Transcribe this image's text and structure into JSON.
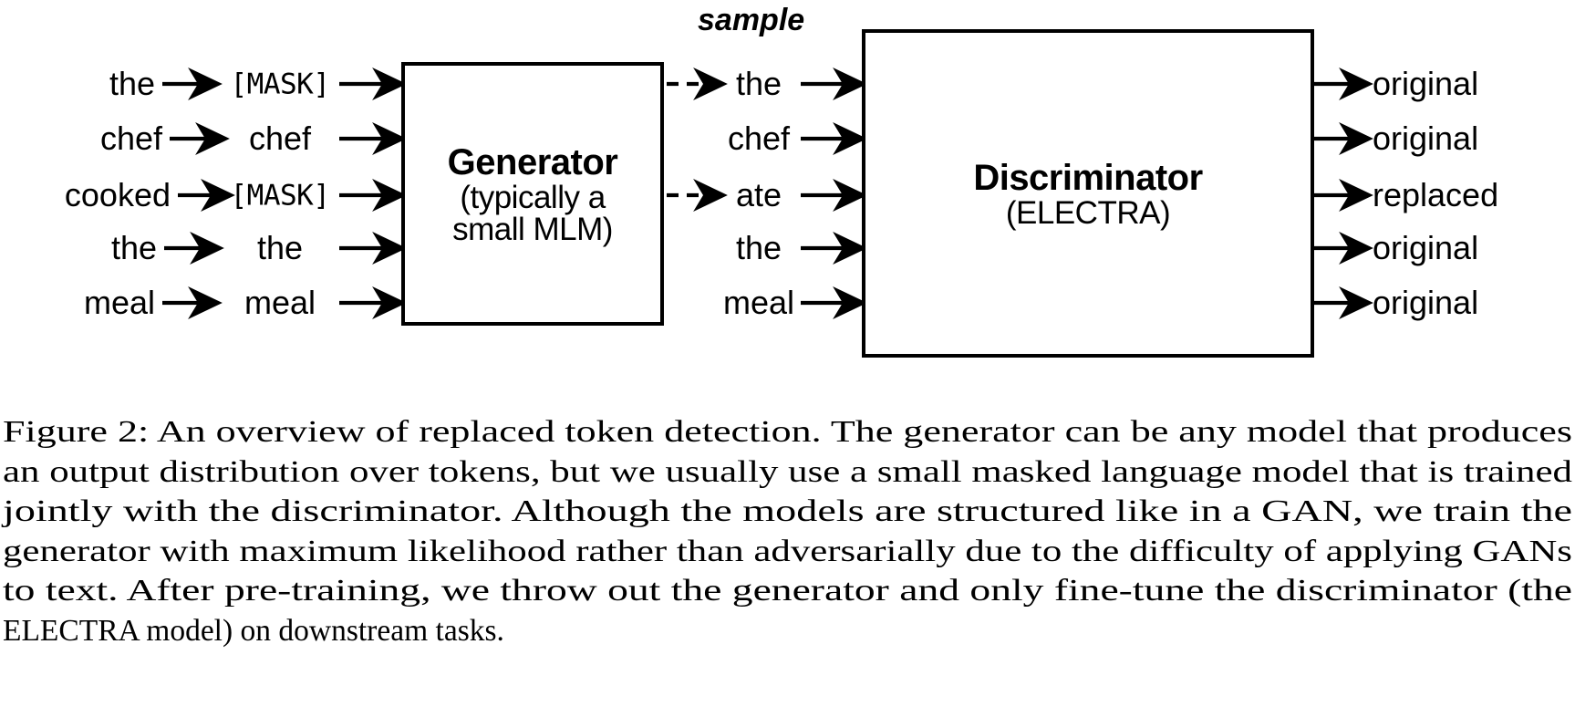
{
  "figure": {
    "sample_label": "sample",
    "rows": [
      {
        "input": "the",
        "masked": "[MASK]",
        "sampled": "the",
        "output": "original",
        "sampled_dashed": true
      },
      {
        "input": "chef",
        "masked": "chef",
        "sampled": "chef",
        "output": "original",
        "sampled_dashed": false
      },
      {
        "input": "cooked",
        "masked": "[MASK]",
        "sampled": "ate",
        "output": "replaced",
        "sampled_dashed": true
      },
      {
        "input": "the",
        "masked": "the",
        "sampled": "the",
        "output": "original",
        "sampled_dashed": false
      },
      {
        "input": "meal",
        "masked": "meal",
        "sampled": "meal",
        "output": "original",
        "sampled_dashed": false
      }
    ],
    "generator": {
      "title": "Generator",
      "subtitle_line1": "(typically a",
      "subtitle_line2": "small MLM)"
    },
    "discriminator": {
      "title": "Discriminator",
      "subtitle_line1": "(ELECTRA)"
    }
  },
  "caption": {
    "line1": "Figure 2: An overview of replaced token detection.  The generator can be any model that produces",
    "line2": "an output distribution over tokens, but we usually use a small masked language model that is trained",
    "line3": "jointly with the discriminator.  Although the models are structured like in a GAN, we train the",
    "line4": "generator with maximum likelihood rather than adversarially due to the difficulty of applying GANs",
    "line5": "to text.  After pre-training, we throw out the generator and only fine-tune the discriminator (the",
    "line6": "ELECTRA model) on downstream tasks."
  },
  "colors": {
    "ink": "#000000",
    "paper": "#ffffff"
  }
}
